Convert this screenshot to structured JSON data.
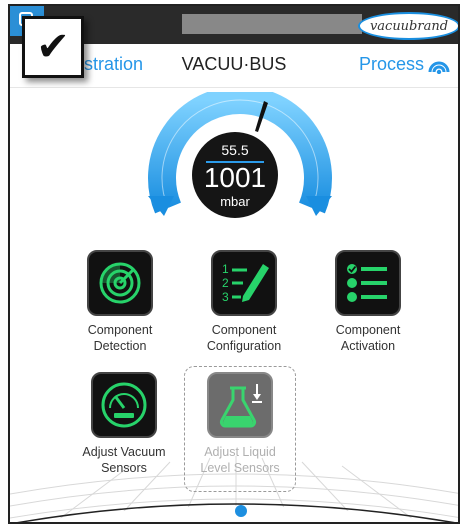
{
  "header": {
    "brand": "vacuubrand"
  },
  "nav": {
    "left_label": "nistration",
    "center_title": "VACUU·BUS",
    "right_label": "Process"
  },
  "overlay": {
    "checkmark": "✔"
  },
  "gauge": {
    "small_value": "55.5",
    "big_value": "1001",
    "unit": "mbar"
  },
  "tiles": [
    {
      "label_line1": "Component",
      "label_line2": "Detection"
    },
    {
      "label_line1": "Component",
      "label_line2": "Configuration"
    },
    {
      "label_line1": "Component",
      "label_line2": "Activation"
    },
    {
      "label_line1": "Adjust Vacuum",
      "label_line2": "Sensors"
    },
    {
      "label_line1": "Adjust Liquid",
      "label_line2": "Level Sensors"
    }
  ],
  "colors": {
    "accent": "#2596e8",
    "icon_green": "#27d36a",
    "tile_bg": "#111111"
  }
}
